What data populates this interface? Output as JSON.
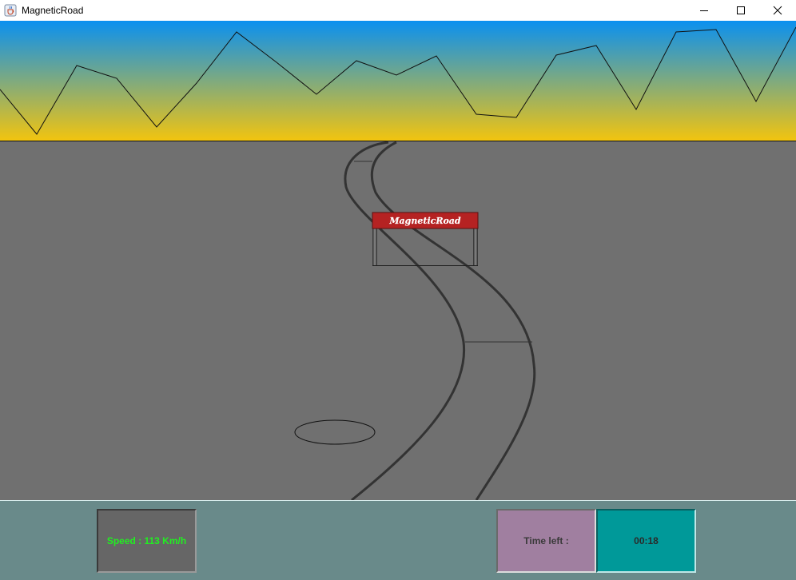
{
  "window": {
    "title": "MagneticRoad",
    "icon": "java-cup-icon",
    "controls": [
      "minimize-icon",
      "maximize-icon",
      "close-icon"
    ]
  },
  "scene": {
    "sky_colors": [
      "#0a90f0",
      "#f2c40f"
    ],
    "ground_color": "#707070",
    "track_color": "#333333",
    "banner": {
      "text": "MagneticRoad",
      "color": "#b52222"
    }
  },
  "hud": {
    "speed": "Speed : 113 Km/h",
    "time_label": "Time left :",
    "time_value": "00:18"
  }
}
